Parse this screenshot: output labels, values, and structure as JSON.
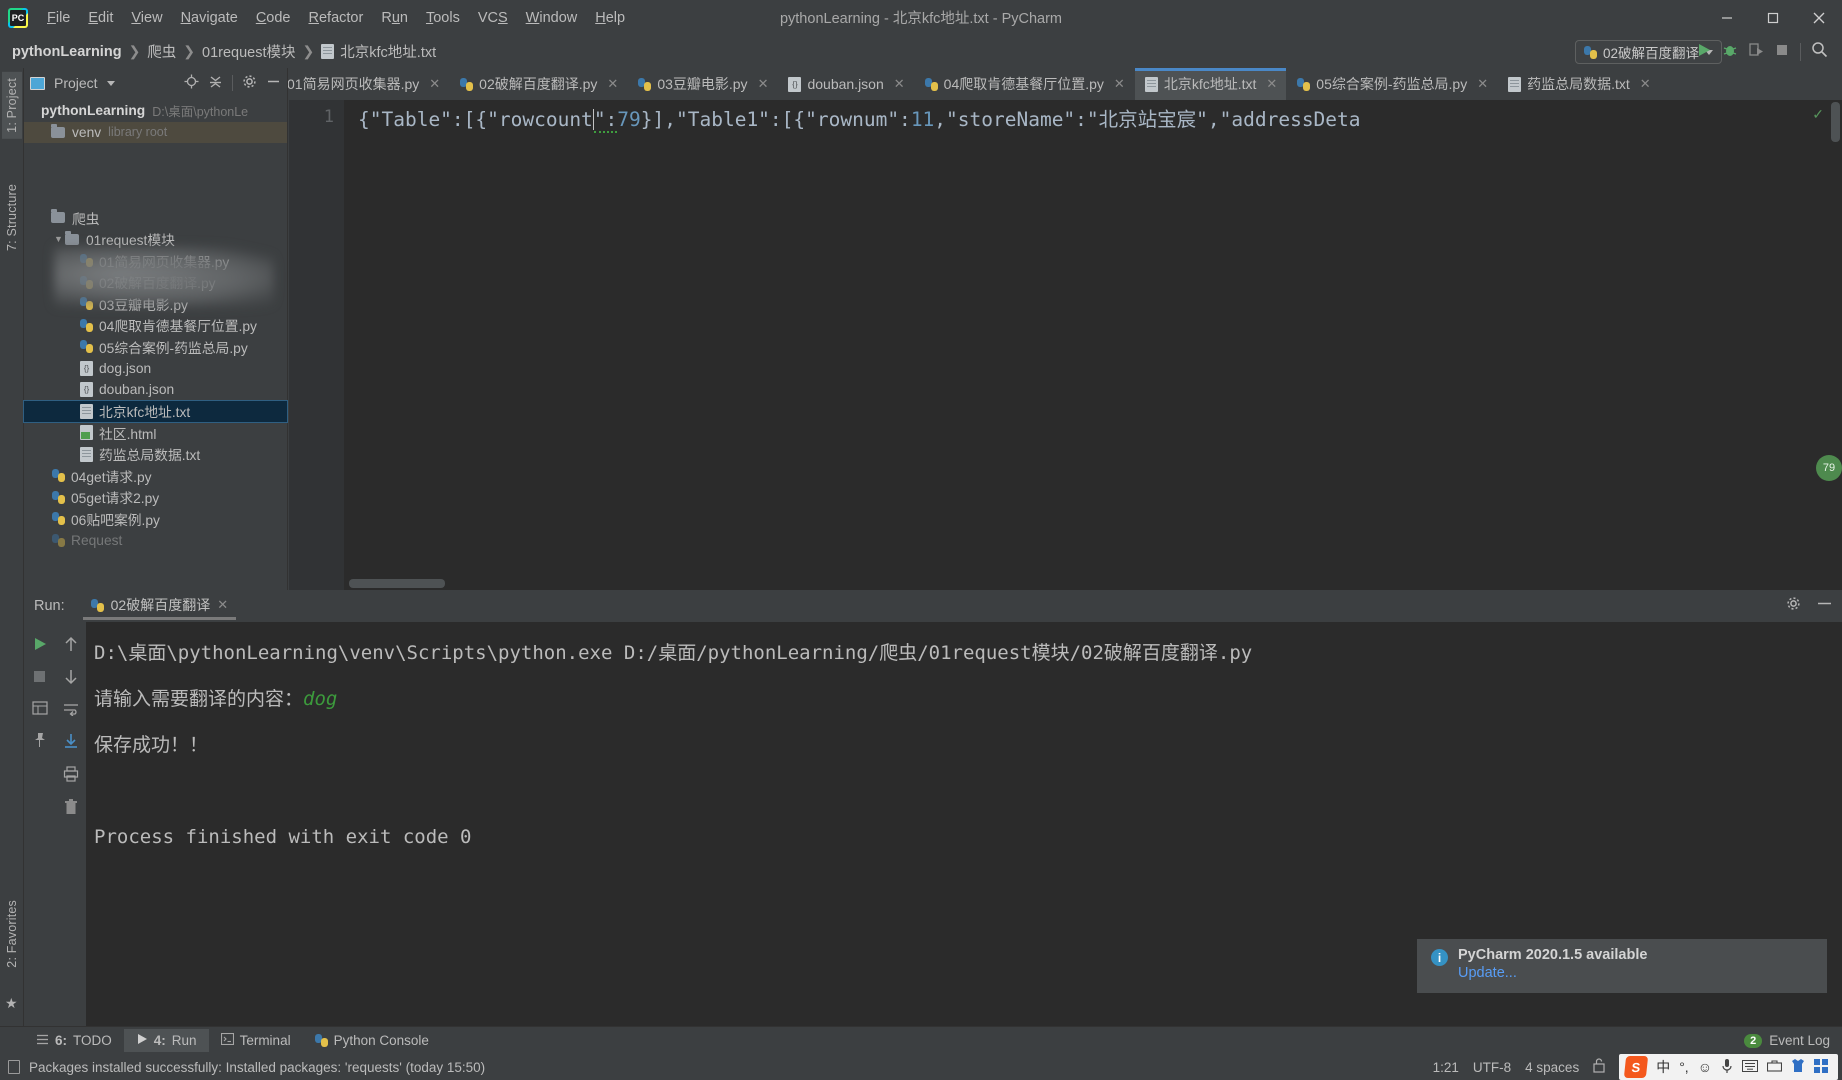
{
  "window": {
    "title": "pythonLearning - 北京kfc地址.txt - PyCharm",
    "minimize": "–",
    "maximize": "▢",
    "close": "✕"
  },
  "menu": {
    "items": [
      {
        "pre": "",
        "accel": "F",
        "post": "ile"
      },
      {
        "pre": "",
        "accel": "E",
        "post": "dit"
      },
      {
        "pre": "",
        "accel": "V",
        "post": "iew"
      },
      {
        "pre": "",
        "accel": "N",
        "post": "avigate"
      },
      {
        "pre": "",
        "accel": "C",
        "post": "ode"
      },
      {
        "pre": "",
        "accel": "R",
        "post": "efactor"
      },
      {
        "pre": "R",
        "accel": "u",
        "post": "n"
      },
      {
        "pre": "",
        "accel": "T",
        "post": "ools"
      },
      {
        "pre": "VC",
        "accel": "S",
        "post": ""
      },
      {
        "pre": "",
        "accel": "W",
        "post": "indow"
      },
      {
        "pre": "",
        "accel": "H",
        "post": "elp"
      }
    ]
  },
  "breadcrumb": {
    "project": "pythonLearning",
    "sep": "❯",
    "folder1": "爬虫",
    "folder2": "01request模块",
    "file": "北京kfc地址.txt"
  },
  "run_config": {
    "name": "02破解百度翻译",
    "run_icon": "run-triangle",
    "debug_icon": "bug",
    "coverage_icon": "run-coverage",
    "stop_icon": "stop-square",
    "search_icon": "magnifier"
  },
  "editor_tabs": [
    {
      "label": "01简易网页收集器.py",
      "icon": "python",
      "active": false
    },
    {
      "label": "02破解百度翻译.py",
      "icon": "python",
      "active": false
    },
    {
      "label": "03豆瓣电影.py",
      "icon": "python",
      "active": false
    },
    {
      "label": "douban.json",
      "icon": "json",
      "active": false
    },
    {
      "label": "04爬取肯德基餐厅位置.py",
      "icon": "python",
      "active": false
    },
    {
      "label": "北京kfc地址.txt",
      "icon": "text",
      "active": true
    },
    {
      "label": "05综合案例-药监总局.py",
      "icon": "python",
      "active": false
    },
    {
      "label": "药监总局数据.txt",
      "icon": "text",
      "active": false
    }
  ],
  "left_strip": {
    "project_tab": "1: Project",
    "structure_tab": "7: Structure",
    "favorites_tab": "2: Favorites",
    "star_icon": "star"
  },
  "project_panel": {
    "title": "Project",
    "icons": [
      "locate-icon",
      "collapse-all-icon",
      "gear-icon",
      "hide-icon"
    ],
    "root": {
      "name": "pythonLearning",
      "path": "D:\\桌面\\pythonLe"
    },
    "tree": [
      {
        "depth": 1,
        "label": "venv",
        "note": "library root",
        "type": "folder",
        "state": "highlight-brown",
        "arrow": ""
      },
      {
        "depth": 1,
        "label": "爬虫",
        "note": "",
        "type": "folder",
        "state": "",
        "arrow": ""
      },
      {
        "depth": 2,
        "label": "01request模块",
        "note": "",
        "type": "folder",
        "state": "",
        "arrow": "▼"
      },
      {
        "depth": 3,
        "label": "01简易网页收集器.py",
        "note": "",
        "type": "python",
        "state": "",
        "arrow": ""
      },
      {
        "depth": 3,
        "label": "02破解百度翻译.py",
        "note": "",
        "type": "python",
        "state": "",
        "arrow": ""
      },
      {
        "depth": 3,
        "label": "03豆瓣电影.py",
        "note": "",
        "type": "python",
        "state": "",
        "arrow": ""
      },
      {
        "depth": 3,
        "label": "04爬取肯德基餐厅位置.py",
        "note": "",
        "type": "python",
        "state": "",
        "arrow": ""
      },
      {
        "depth": 3,
        "label": "05综合案例-药监总局.py",
        "note": "",
        "type": "python",
        "state": "",
        "arrow": ""
      },
      {
        "depth": 3,
        "label": "dog.json",
        "note": "",
        "type": "json",
        "state": "",
        "arrow": ""
      },
      {
        "depth": 3,
        "label": "douban.json",
        "note": "",
        "type": "json",
        "state": "",
        "arrow": ""
      },
      {
        "depth": 3,
        "label": "北京kfc地址.txt",
        "note": "",
        "type": "text",
        "state": "selected",
        "arrow": ""
      },
      {
        "depth": 3,
        "label": "社区.html",
        "note": "",
        "type": "html",
        "state": "",
        "arrow": ""
      },
      {
        "depth": 3,
        "label": "药监总局数据.txt",
        "note": "",
        "type": "text",
        "state": "",
        "arrow": ""
      },
      {
        "depth": 2,
        "label": "04get请求.py",
        "note": "",
        "type": "python",
        "state": "",
        "arrow": ""
      },
      {
        "depth": 2,
        "label": "05get请求2.py",
        "note": "",
        "type": "python",
        "state": "",
        "arrow": ""
      },
      {
        "depth": 2,
        "label": "06贴吧案例.py",
        "note": "",
        "type": "python",
        "state": "",
        "arrow": ""
      }
    ]
  },
  "editor": {
    "line_number": "1",
    "code_parts": {
      "p1": "{\"Table\":[{\"rowcount",
      "p2": "\":",
      "p3": "79",
      "p4": "}],\"Table1\":[{\"rownum\":",
      "p5": "11",
      "p6": ",\"storeName\":\"北京站宝宸\",\"addressDeta"
    },
    "full_text": "{\"Table\":[{\"rowcount\":79}],\"Table1\":[{\"rownum\":11,\"storeName\":\"北京站宝宸\",\"addressDeta",
    "inspection_ok": "✓",
    "scroll_marker": "79"
  },
  "run_window": {
    "label": "Run:",
    "tab_name": "02破解百度翻译",
    "close_x": "✕",
    "header_icons": [
      "gear-icon",
      "minimize-icon"
    ],
    "sidebar_icons": [
      "run-icon",
      "up-arrow-icon",
      "stop-icon",
      "down-arrow-icon",
      "print-grid-icon",
      "soft-wrap-icon",
      "pin-icon",
      "scroll-end-icon",
      "print-icon",
      "trash-icon"
    ],
    "console_lines": [
      {
        "text": "D:\\桌面\\pythonLearning\\venv\\Scripts\\python.exe D:/桌面/pythonLearning/爬虫/01request模块/02破解百度翻译.py",
        "style": "normal"
      },
      {
        "text": "请输入需要翻译的内容：",
        "style": "normal",
        "suffix": "dog",
        "suffix_style": "green"
      },
      {
        "text": "保存成功！！",
        "style": "normal"
      },
      {
        "text": "",
        "style": "normal"
      },
      {
        "text": "Process finished with exit code 0",
        "style": "normal"
      }
    ]
  },
  "notification": {
    "icon": "info-icon",
    "title": "PyCharm 2020.1.5 available",
    "link": "Update..."
  },
  "bottom_tabs": [
    {
      "num": "6:",
      "label": "TODO",
      "icon": "todo-icon",
      "active": false
    },
    {
      "num": "4:",
      "label": "Run",
      "icon": "run-triangle-icon",
      "active": true
    },
    {
      "num": "",
      "label": "Terminal",
      "icon": "terminal-icon",
      "active": false
    },
    {
      "num": "",
      "label": "Python Console",
      "icon": "python-icon",
      "active": false
    }
  ],
  "event_log": {
    "badge": "2",
    "label": "Event Log"
  },
  "statusbar": {
    "message": "Packages installed successfully: Installed packages: 'requests' (today 15:50)",
    "caret_position": "1:21",
    "encoding": "UTF-8",
    "indent": "4 spaces",
    "lock_icon": "unlocked-padlock"
  },
  "tray": {
    "sogou": "S",
    "lang": "中",
    "punct": "°,",
    "emoji": "☺",
    "mic": "mic-icon",
    "keyboard": "keyboard-icon",
    "toolbox": "toolbox-icon",
    "shirt": "skin-icon",
    "grid": "apps-icon"
  },
  "colors": {
    "panel_bg": "#3c3f41",
    "editor_bg": "#2b2b2b",
    "accent_blue": "#4a88c7",
    "selection_blue": "#0d293e",
    "link_blue": "#589df6",
    "green": "#3c9a3c",
    "number_blue": "#6897bb"
  }
}
